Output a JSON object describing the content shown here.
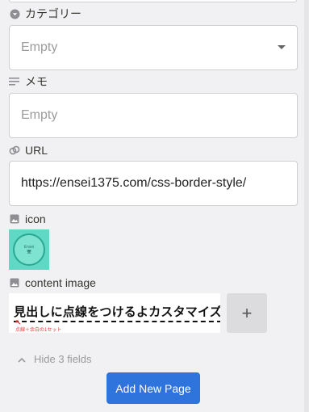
{
  "properties": {
    "category": {
      "label": "カテゴリー",
      "icon": "dropdown-circle-icon",
      "placeholder": "Empty"
    },
    "memo": {
      "label": "メモ",
      "icon": "text-lines-icon",
      "placeholder": "Empty"
    },
    "url": {
      "label": "URL",
      "icon": "link-icon",
      "value": "https://ensei1375.com/css-border-style/"
    },
    "icon_prop": {
      "label": "icon",
      "icon": "image-icon",
      "thumb_text_line1": "Ensei",
      "thumb_text_line2": "🖥"
    },
    "content_image": {
      "label": "content image",
      "icon": "image-icon",
      "headline": "見出しに点線をつけるよカスタマイズ",
      "note": "点線＋余白の1セット",
      "add_label": "+"
    }
  },
  "hide_fields": {
    "label": "Hide 3 fields",
    "icon": "chevron-up-icon"
  },
  "primary_action": {
    "label": "Add New Page"
  },
  "colors": {
    "accent": "#2f73dc",
    "thumb_bg": "#5fd9c4",
    "note_red": "#e33333"
  }
}
